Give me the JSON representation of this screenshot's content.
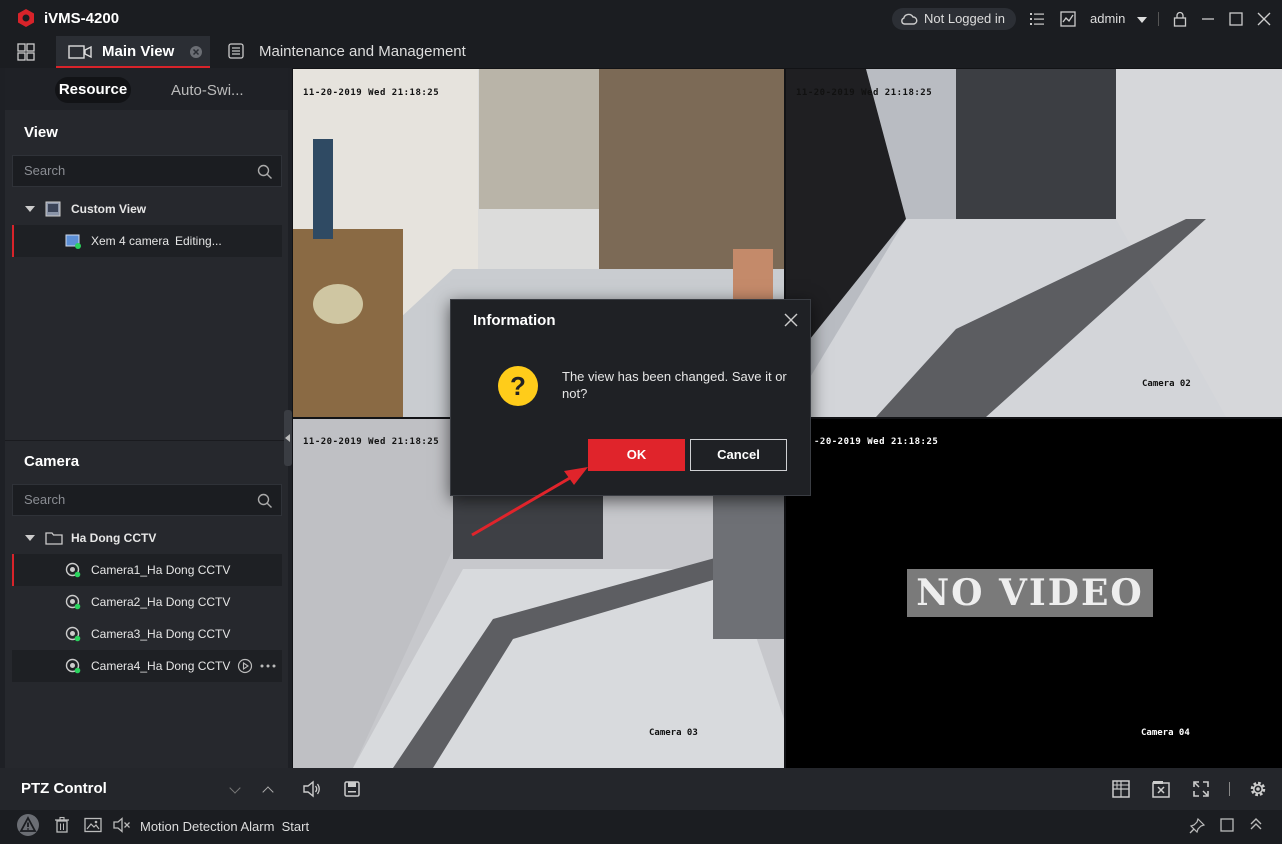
{
  "app": {
    "title": "iVMS-4200",
    "brand_color": "#d8232a"
  },
  "titlebar": {
    "login_status": "Not Logged in",
    "user": "admin"
  },
  "tabs": {
    "main": "Main View",
    "maintenance": "Maintenance and Management"
  },
  "sidebar": {
    "tabs": {
      "resource": "Resource",
      "auto_switch": "Auto-Swi..."
    },
    "view": {
      "title": "View",
      "search_placeholder": "Search",
      "group": "Custom View",
      "item_name": "Xem 4 camera",
      "item_status": "Editing..."
    },
    "camera": {
      "title": "Camera",
      "search_placeholder": "Search",
      "group": "Ha Dong CCTV",
      "items": [
        "Camera1_Ha Dong CCTV",
        "Camera2_Ha Dong CCTV",
        "Camera3_Ha Dong CCTV",
        "Camera4_Ha Dong CCTV"
      ]
    }
  },
  "video": {
    "timestamp": "11-20-2019 Wed 21:18:25",
    "timestamp_cut": "-20-2019 Wed 21:18:25",
    "cam2": "Camera 02",
    "cam3": "Camera 03",
    "cam4": "Camera 04",
    "no_video": "NO VIDEO"
  },
  "bottom": {
    "ptz": "PTZ Control"
  },
  "status": {
    "text": "Motion Detection Alarm  Start"
  },
  "dialog": {
    "title": "Information",
    "message": "The view has been changed. Save it or not?",
    "ok": "OK",
    "cancel": "Cancel"
  }
}
